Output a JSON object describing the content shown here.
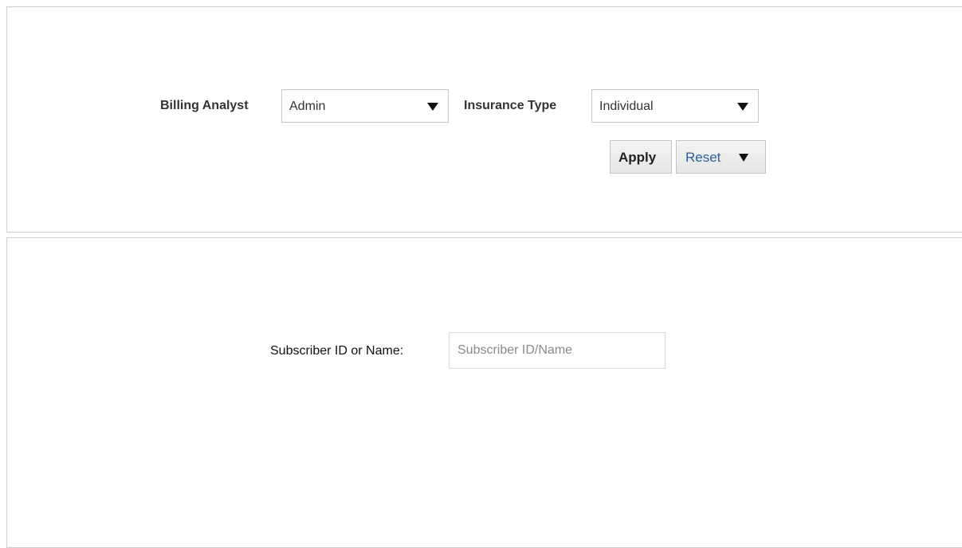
{
  "filters": {
    "billing_analyst": {
      "label": "Billing Analyst",
      "selected": "Admin"
    },
    "insurance_type": {
      "label": "Insurance Type",
      "selected": "Individual"
    },
    "apply_label": "Apply",
    "reset_label": "Reset"
  },
  "search": {
    "label": "Subscriber ID or Name:",
    "value": "",
    "placeholder": "Subscriber ID/Name"
  },
  "colors": {
    "reset_text": "#2a5fa0",
    "border": "#cfcfcf"
  },
  "icons": {
    "dropdown": "chevron-down-icon",
    "menu_caret": "caret-down-icon"
  }
}
